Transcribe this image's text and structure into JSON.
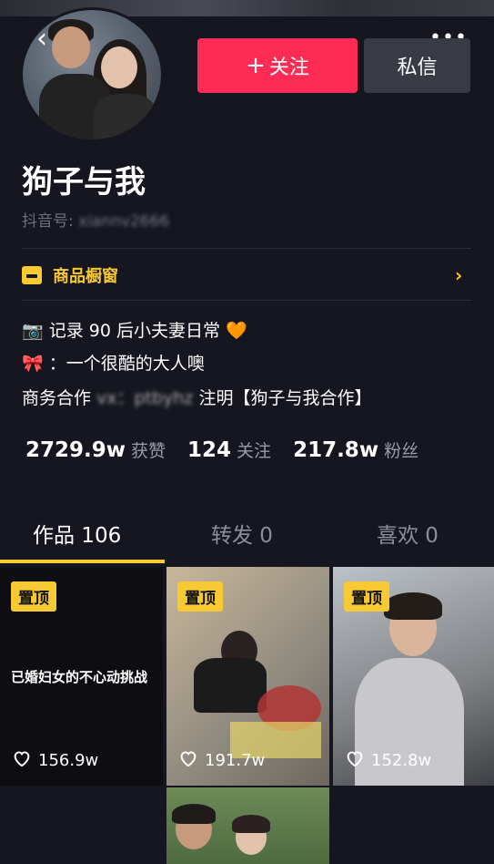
{
  "header": {
    "follow_label": "关注",
    "follow_plus": "+",
    "message_label": "私信",
    "more_icon": "more-dots-icon"
  },
  "profile": {
    "name": "狗子与我",
    "douyin_id_label": "抖音号:",
    "douyin_id_value": "xiannv2666"
  },
  "shop": {
    "label": "商品橱窗",
    "icon": "shop-icon"
  },
  "bio": {
    "line1_icon": "📷",
    "line1_text": "记录 90 后小夫妻日常",
    "line1_end": "🧡",
    "line2_icon": "🎀",
    "line2_text": "：一个很酷的大人噢",
    "line3_prefix": "商务合作",
    "line3_blur": "vx：ptbyhz",
    "line3_suffix": "注明【狗子与我合作】"
  },
  "stats": {
    "likes_value": "2729.9w",
    "likes_label": "获赞",
    "following_value": "124",
    "following_label": "关注",
    "fans_value": "217.8w",
    "fans_label": "粉丝"
  },
  "tabs": [
    {
      "label": "作品 106",
      "active": true
    },
    {
      "label": "转发 0",
      "active": false
    },
    {
      "label": "喜欢 0",
      "active": false
    }
  ],
  "videos": [
    {
      "pinned_label": "置顶",
      "caption": "已婚妇女的不心动挑战",
      "likes": "156.9w"
    },
    {
      "pinned_label": "置顶",
      "likes": "191.7w"
    },
    {
      "pinned_label": "置顶",
      "likes": "152.8w"
    }
  ],
  "colors": {
    "accent_red": "#fe2c55",
    "accent_yellow": "#f7c933",
    "background": "#15161f"
  }
}
